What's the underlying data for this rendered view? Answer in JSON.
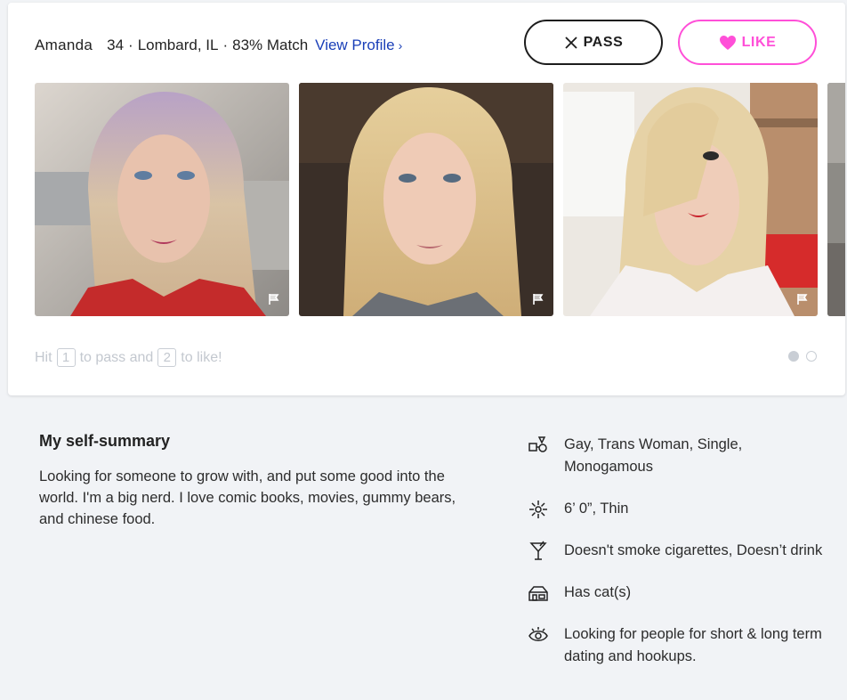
{
  "profile": {
    "name": "Amanda",
    "age": "34",
    "location": "Lombard, IL",
    "match": "83% Match",
    "view_profile_label": "View Profile"
  },
  "actions": {
    "pass_label": "PASS",
    "like_label": "LIKE"
  },
  "hint": {
    "prefix": "Hit",
    "pass_key": "1",
    "middle": "to pass and",
    "like_key": "2",
    "suffix": "to like!"
  },
  "pagination": {
    "pages": 2,
    "current": 1
  },
  "summary": {
    "title": "My self-summary",
    "text": "Looking for someone to grow with, and put some good into the world. I'm a big nerd. I love comic books, movies, gummy bears, and chinese food."
  },
  "details": [
    {
      "icon": "orientation-icon",
      "text": "Gay, Trans Woman, Single, Monogamous"
    },
    {
      "icon": "body-icon",
      "text": "6’ 0”, Thin"
    },
    {
      "icon": "cocktail-icon",
      "text": "Doesn't smoke cigarettes, Doesn’t drink"
    },
    {
      "icon": "pet-house-icon",
      "text": "Has cat(s)"
    },
    {
      "icon": "eye-icon",
      "text": "Looking for people for short & long term dating and hookups."
    }
  ],
  "colors": {
    "like_accent": "#ff4fd8",
    "link": "#1a3fb8",
    "page_background": "#f1f3f6"
  }
}
